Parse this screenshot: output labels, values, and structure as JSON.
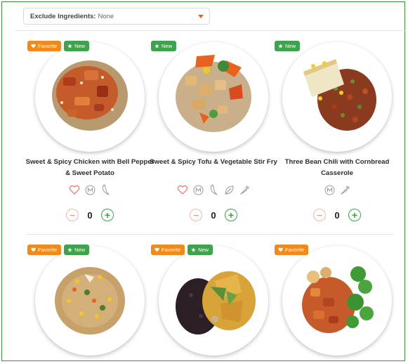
{
  "filter": {
    "label": "Exclude Ingredients:",
    "value": "None"
  },
  "badges": {
    "favorite": "Favorite",
    "new": "New"
  },
  "colors": {
    "favorite": "#f08a1c",
    "new": "#3ea44c",
    "minus": "#f08a80",
    "plus": "#3ea44c",
    "caret": "#e8611a"
  },
  "meals": [
    {
      "title": "Sweet & Spicy Chicken with Bell Pepper & Sweet Potato",
      "favorite": true,
      "new": true,
      "quantity": "0",
      "icons": [
        "heart-icon",
        "m-badge-icon",
        "pepper-icon"
      ]
    },
    {
      "title": "Sweet & Spicy Tofu & Vegetable Stir Fry",
      "favorite": false,
      "new": true,
      "quantity": "0",
      "icons": [
        "heart-icon",
        "m-badge-icon",
        "pepper-icon",
        "leaf-icon",
        "carrot-icon"
      ]
    },
    {
      "title": "Three Bean Chili with Cornbread Casserole",
      "favorite": false,
      "new": true,
      "quantity": "0",
      "icons": [
        "m-badge-icon",
        "carrot-icon"
      ]
    },
    {
      "title": "",
      "favorite": true,
      "new": true
    },
    {
      "title": "",
      "favorite": true,
      "new": true
    },
    {
      "title": "",
      "favorite": true,
      "new": false
    }
  ],
  "quantity_controls": {
    "minus": "−",
    "plus": "+"
  }
}
